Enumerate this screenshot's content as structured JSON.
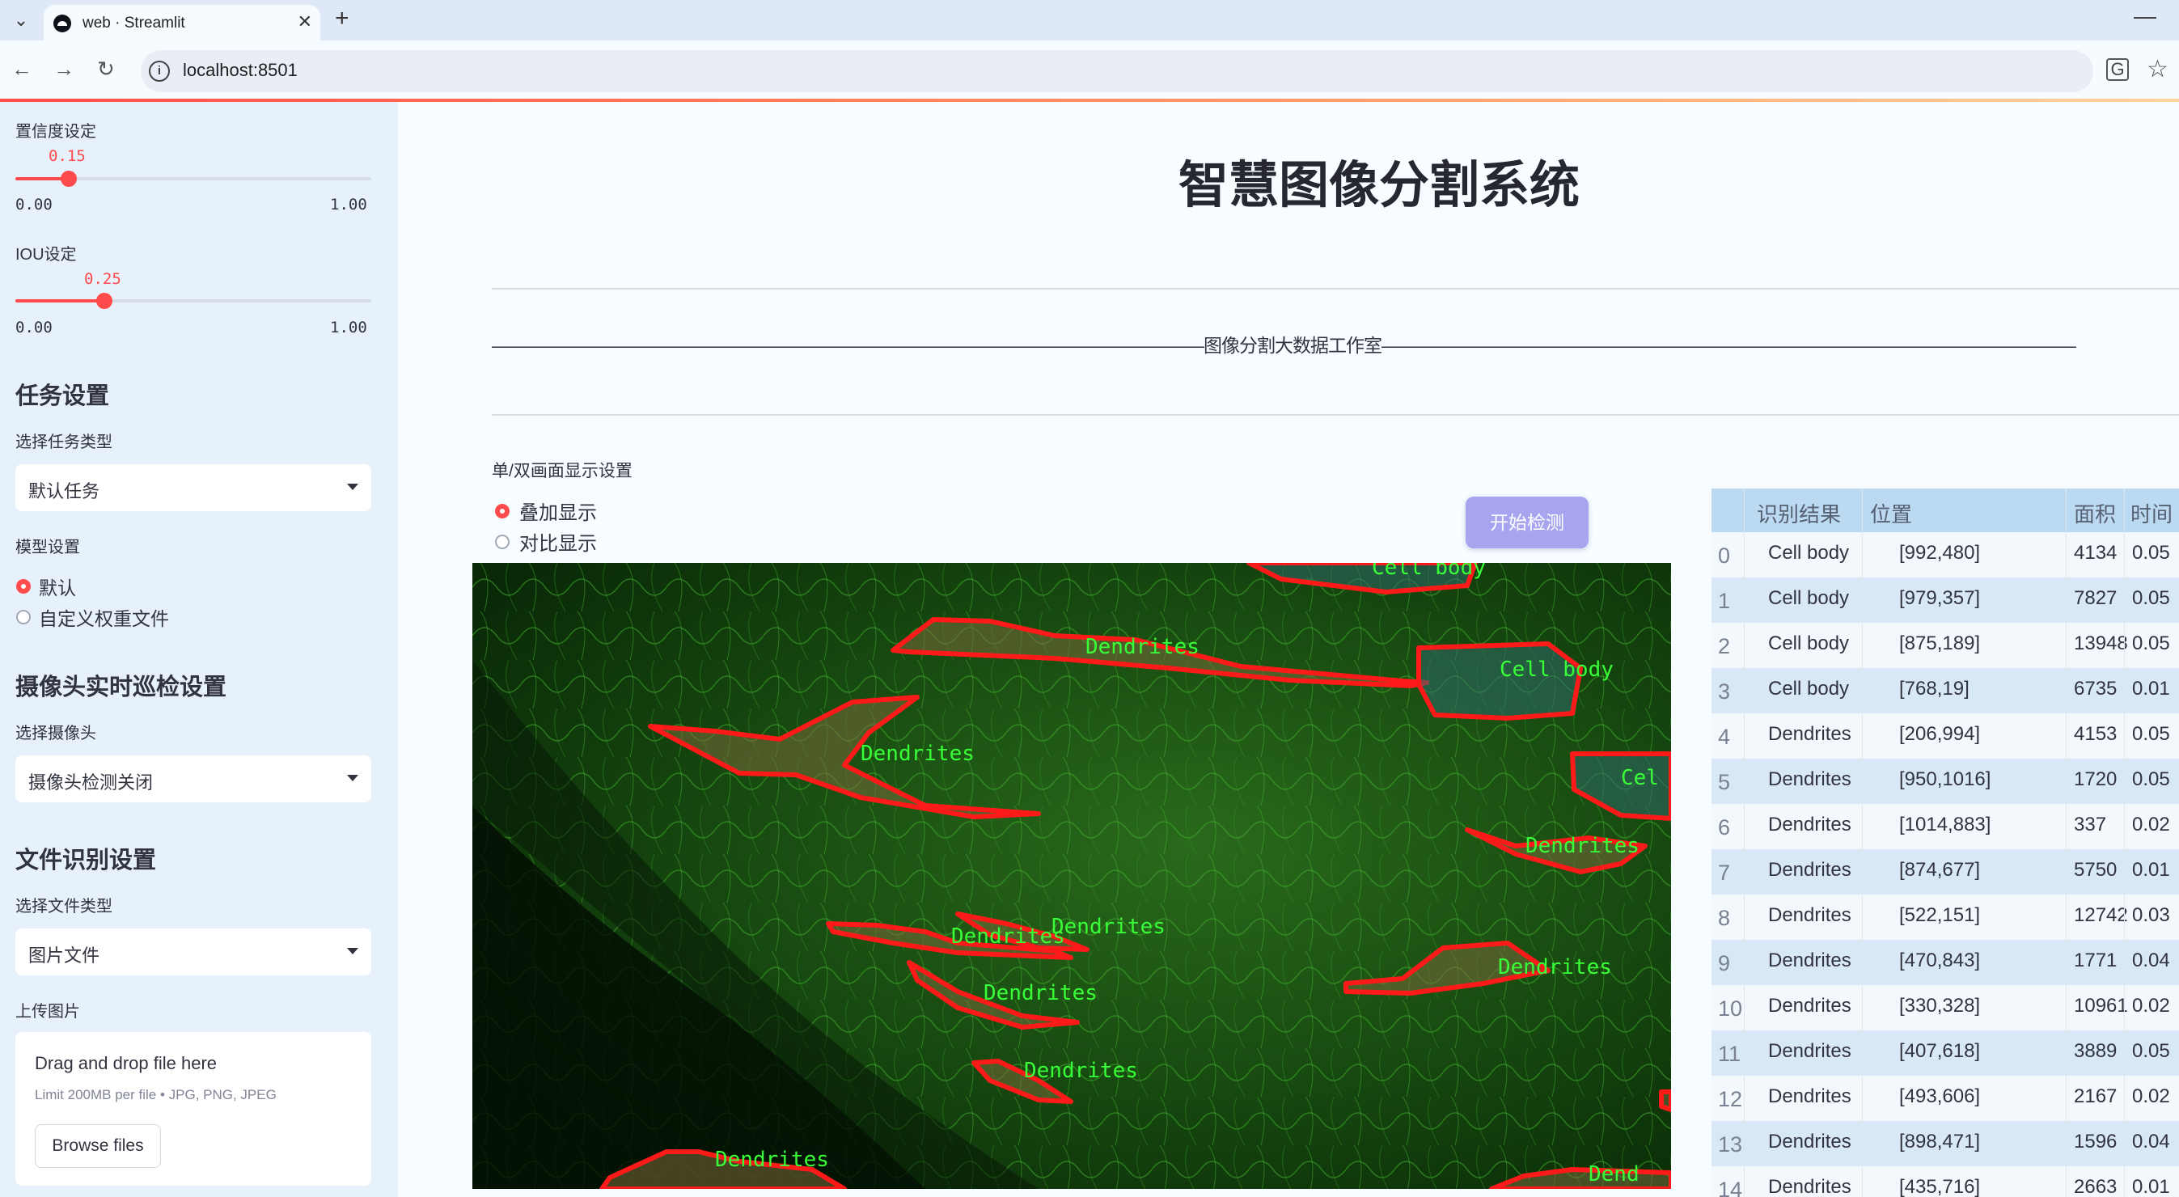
{
  "browser": {
    "tab_title": "web · Streamlit",
    "url": "localhost:8501"
  },
  "sidebar": {
    "confidence": {
      "label": "置信度设定",
      "value": "0.15",
      "min": "0.00",
      "max": "1.00",
      "fraction": 0.15
    },
    "iou": {
      "label": "IOU设定",
      "value": "0.25",
      "min": "0.00",
      "max": "1.00",
      "fraction": 0.25
    },
    "task_header": "任务设置",
    "task_type_label": "选择任务类型",
    "task_type_value": "默认任务",
    "model_label": "模型设置",
    "model_options": [
      "默认",
      "自定义权重文件"
    ],
    "model_selected": 0,
    "camera_header": "摄像头实时巡检设置",
    "camera_label": "选择摄像头",
    "camera_value": "摄像头检测关闭",
    "file_header": "文件识别设置",
    "file_type_label": "选择文件类型",
    "file_type_value": "图片文件",
    "upload_label": "上传图片",
    "upload_title": "Drag and drop file here",
    "upload_limit": "Limit 200MB per file • JPG, PNG, JPEG",
    "browse_label": "Browse files"
  },
  "main": {
    "title": "智慧图像分割系统",
    "banner": "————————————————————————————————————————图像分割大数据工作室———————————————————————————————————————",
    "display_label": "单/双画面显示设置",
    "display_options": [
      "叠加显示",
      "对比显示"
    ],
    "display_selected": 0,
    "detect_button": "开始检测"
  },
  "image_labels": {
    "cell_body": "Cell body",
    "cell_body_cut1": "Cel",
    "dendrites": "Dendrites",
    "dendrites_cut1": "Dendrites",
    "dendrites_cut2": "Dend"
  },
  "table": {
    "headers": [
      "识别结果",
      "位置",
      "面积",
      "时间"
    ],
    "rows": [
      {
        "idx": "0",
        "label": "Cell body",
        "pos": "[992,480]",
        "area": "4134",
        "time": "0.05"
      },
      {
        "idx": "1",
        "label": "Cell body",
        "pos": "[979,357]",
        "area": "7827",
        "time": "0.05"
      },
      {
        "idx": "2",
        "label": "Cell body",
        "pos": "[875,189]",
        "area": "13948",
        "time": "0.05"
      },
      {
        "idx": "3",
        "label": "Cell body",
        "pos": "[768,19]",
        "area": "6735",
        "time": "0.01"
      },
      {
        "idx": "4",
        "label": "Dendrites",
        "pos": "[206,994]",
        "area": "4153",
        "time": "0.05"
      },
      {
        "idx": "5",
        "label": "Dendrites",
        "pos": "[950,1016]",
        "area": "1720",
        "time": "0.05"
      },
      {
        "idx": "6",
        "label": "Dendrites",
        "pos": "[1014,883]",
        "area": "337",
        "time": "0.02"
      },
      {
        "idx": "7",
        "label": "Dendrites",
        "pos": "[874,677]",
        "area": "5750",
        "time": "0.01"
      },
      {
        "idx": "8",
        "label": "Dendrites",
        "pos": "[522,151]",
        "area": "12742",
        "time": "0.03"
      },
      {
        "idx": "9",
        "label": "Dendrites",
        "pos": "[470,843]",
        "area": "1771",
        "time": "0.04"
      },
      {
        "idx": "10",
        "label": "Dendrites",
        "pos": "[330,328]",
        "area": "10961",
        "time": "0.02"
      },
      {
        "idx": "11",
        "label": "Dendrites",
        "pos": "[407,618]",
        "area": "3889",
        "time": "0.05"
      },
      {
        "idx": "12",
        "label": "Dendrites",
        "pos": "[493,606]",
        "area": "2167",
        "time": "0.02"
      },
      {
        "idx": "13",
        "label": "Dendrites",
        "pos": "[898,471]",
        "area": "1596",
        "time": "0.04"
      },
      {
        "idx": "14",
        "label": "Dendrites",
        "pos": "[435,716]",
        "area": "2663",
        "time": "0.01"
      }
    ]
  },
  "colors": {
    "accent": "#ff4b4b",
    "button": "#a7a5f0",
    "mask_outline": "#ff1a1a",
    "label_text": "#39ff39"
  }
}
